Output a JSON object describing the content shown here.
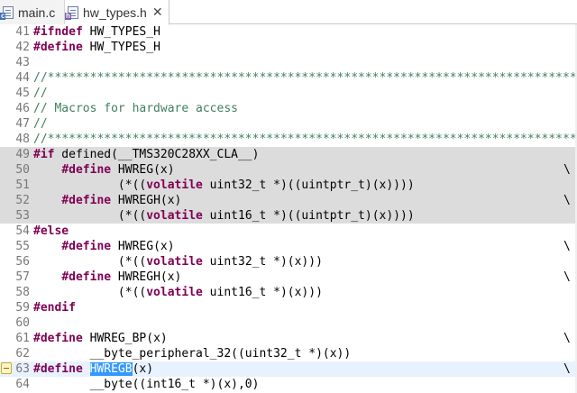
{
  "tabs": [
    {
      "label": "main.c",
      "icon": "c-source-file-icon",
      "icon_letter": "c",
      "active": false
    },
    {
      "label": "hw_types.h",
      "icon": "c-header-file-icon",
      "icon_letter": "h",
      "active": true,
      "close": "✕"
    }
  ],
  "editor": {
    "lines": [
      {
        "n": "41",
        "code": "#ifndef HW_TYPES_H"
      },
      {
        "n": "42",
        "code": "#define HW_TYPES_H"
      },
      {
        "n": "43",
        "code": ""
      },
      {
        "n": "44",
        "code": "//*****************************************************************************"
      },
      {
        "n": "45",
        "code": "//"
      },
      {
        "n": "46",
        "code": "// Macros for hardware access"
      },
      {
        "n": "47",
        "code": "//"
      },
      {
        "n": "48",
        "code": "//*****************************************************************************"
      },
      {
        "n": "49",
        "code": "#if defined(__TMS320C28XX_CLA__)"
      },
      {
        "n": "50",
        "code": "    #define HWREG(x)",
        "cont": "\\"
      },
      {
        "n": "51",
        "code": "            (*((volatile uint32_t *)((uintptr_t)(x))))"
      },
      {
        "n": "52",
        "code": "    #define HWREGH(x)",
        "cont": "\\"
      },
      {
        "n": "53",
        "code": "            (*((volatile uint16_t *)((uintptr_t)(x))))"
      },
      {
        "n": "54",
        "code": "#else"
      },
      {
        "n": "55",
        "code": "    #define HWREG(x)",
        "cont": "\\"
      },
      {
        "n": "56",
        "code": "            (*((volatile uint32_t *)(x)))"
      },
      {
        "n": "57",
        "code": "    #define HWREGH(x)",
        "cont": "\\"
      },
      {
        "n": "58",
        "code": "            (*((volatile uint16_t *)(x)))"
      },
      {
        "n": "59",
        "code": "#endif"
      },
      {
        "n": "60",
        "code": ""
      },
      {
        "n": "61",
        "code": "#define HWREG_BP(x)",
        "cont": "\\"
      },
      {
        "n": "62",
        "code": "        __byte_peripheral_32((uint32_t *)(x))"
      },
      {
        "n": "63",
        "code": "#define HWREGB(x)",
        "cont": "\\",
        "selected": "HWREGB"
      },
      {
        "n": "64",
        "code": "        __byte((int16_t *)(x),0)"
      }
    ],
    "highlight_colors": {
      "inactive_block": "#dcdcdc",
      "current_line": "#e8f2fe",
      "selection": "#3399ff"
    },
    "syntax_colors": {
      "keyword": "#7f0055",
      "comment": "#3f7f5f",
      "line_number": "#787878"
    }
  }
}
